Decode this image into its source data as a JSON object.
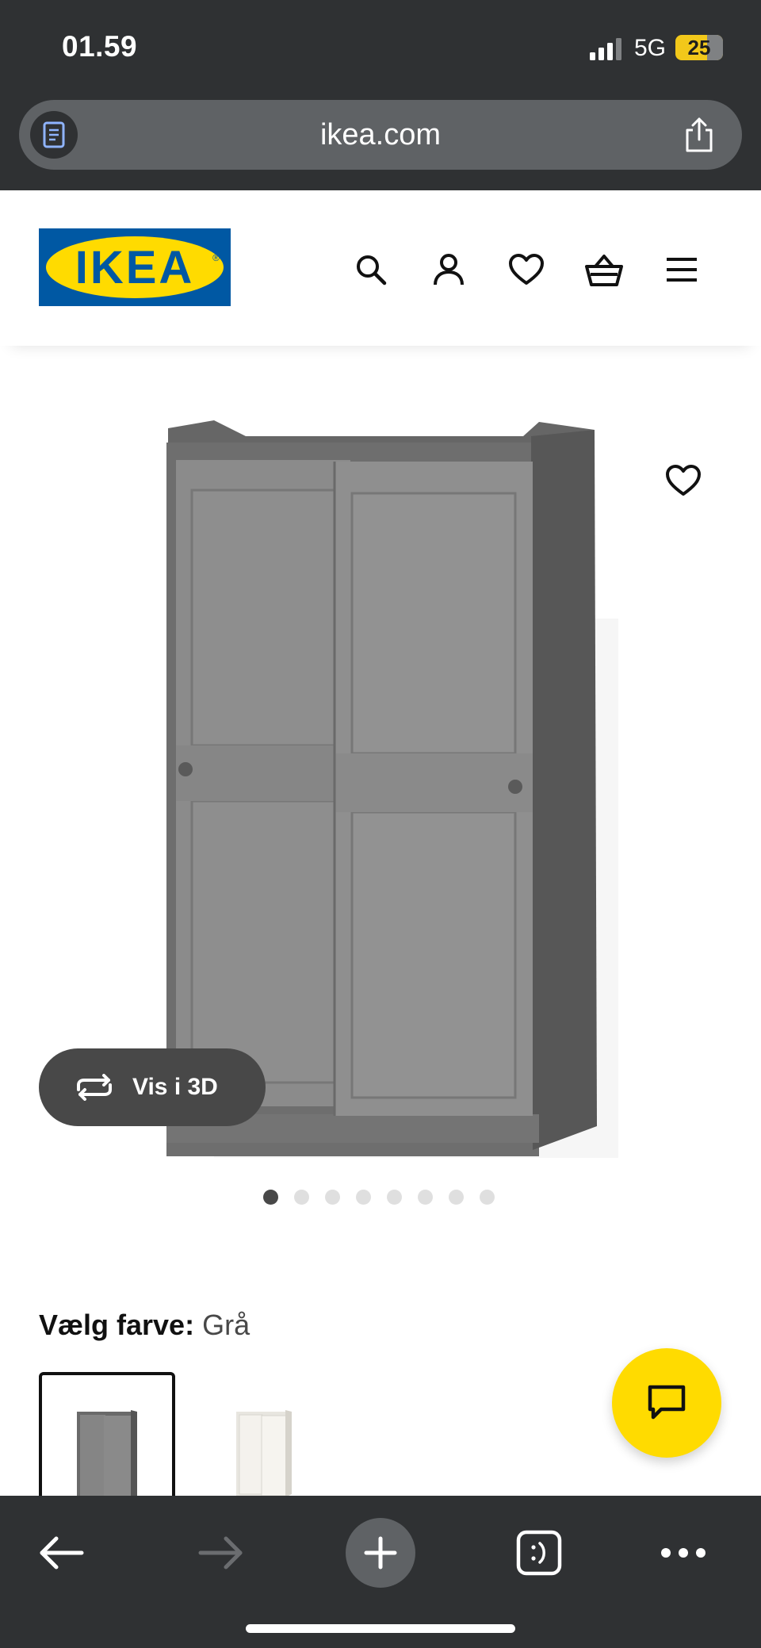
{
  "status_bar": {
    "time": "01.59",
    "network": "5G",
    "battery": "25"
  },
  "browser": {
    "url": "ikea.com",
    "reader_icon": "reader-icon",
    "share_icon": "share-icon"
  },
  "header": {
    "logo_text": "IKEA",
    "icons": [
      "search-icon",
      "account-icon",
      "heart-icon",
      "basket-icon",
      "menu-icon"
    ]
  },
  "product": {
    "view_3d_label": "Vis i 3D",
    "carousel": {
      "count": 8,
      "active_index": 0
    }
  },
  "color_select": {
    "label": "Vælg farve:",
    "selected": "Grå",
    "options": [
      "grey",
      "white"
    ]
  },
  "colors": {
    "ikea_blue": "#0058a3",
    "ikea_yellow": "#ffdb00",
    "chrome_dark": "#2f3133",
    "wardrobe_grey": "#8a8a8a"
  },
  "toolbar": {
    "icons": [
      "back-icon",
      "forward-icon",
      "new-tab-icon",
      "tabs-icon",
      "more-icon"
    ]
  }
}
